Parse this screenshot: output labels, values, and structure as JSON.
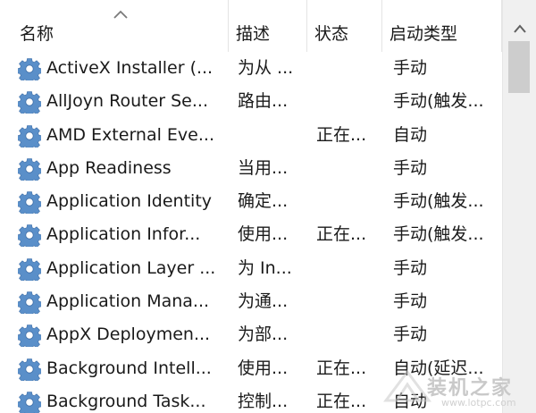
{
  "columns": {
    "name": "名称",
    "description": "描述",
    "status": "状态",
    "startup_type": "启动类型"
  },
  "rows": [
    {
      "name": "ActiveX Installer (...",
      "description": "为从 ...",
      "status": "",
      "startup_type": "手动"
    },
    {
      "name": "AllJoyn Router Se...",
      "description": "路由...",
      "status": "",
      "startup_type": "手动(触发..."
    },
    {
      "name": "AMD External Eve...",
      "description": "",
      "status": "正在...",
      "startup_type": "自动"
    },
    {
      "name": "App Readiness",
      "description": "当用...",
      "status": "",
      "startup_type": "手动"
    },
    {
      "name": "Application Identity",
      "description": "确定...",
      "status": "",
      "startup_type": "手动(触发..."
    },
    {
      "name": "Application Infor...",
      "description": "使用...",
      "status": "正在...",
      "startup_type": "手动(触发..."
    },
    {
      "name": "Application Layer ...",
      "description": "为 In...",
      "status": "",
      "startup_type": "手动"
    },
    {
      "name": "Application Mana...",
      "description": "为通...",
      "status": "",
      "startup_type": "手动"
    },
    {
      "name": "AppX Deploymen...",
      "description": "为部...",
      "status": "",
      "startup_type": "手动"
    },
    {
      "name": "Background Intell...",
      "description": "使用...",
      "status": "正在...",
      "startup_type": "自动(延迟..."
    },
    {
      "name": "Background Task...",
      "description": "控制...",
      "status": "正在...",
      "startup_type": "自动"
    }
  ],
  "watermark": {
    "text": "装机之家",
    "url": "www.lotpc.com"
  },
  "icons": {
    "row_icon": "gear-icon",
    "sort": "sort-ascending-icon",
    "scroll_up": "scroll-up-arrow-icon"
  },
  "colors": {
    "gear": "#5a8fc9",
    "scroll_thumb": "#cdcdcd"
  }
}
